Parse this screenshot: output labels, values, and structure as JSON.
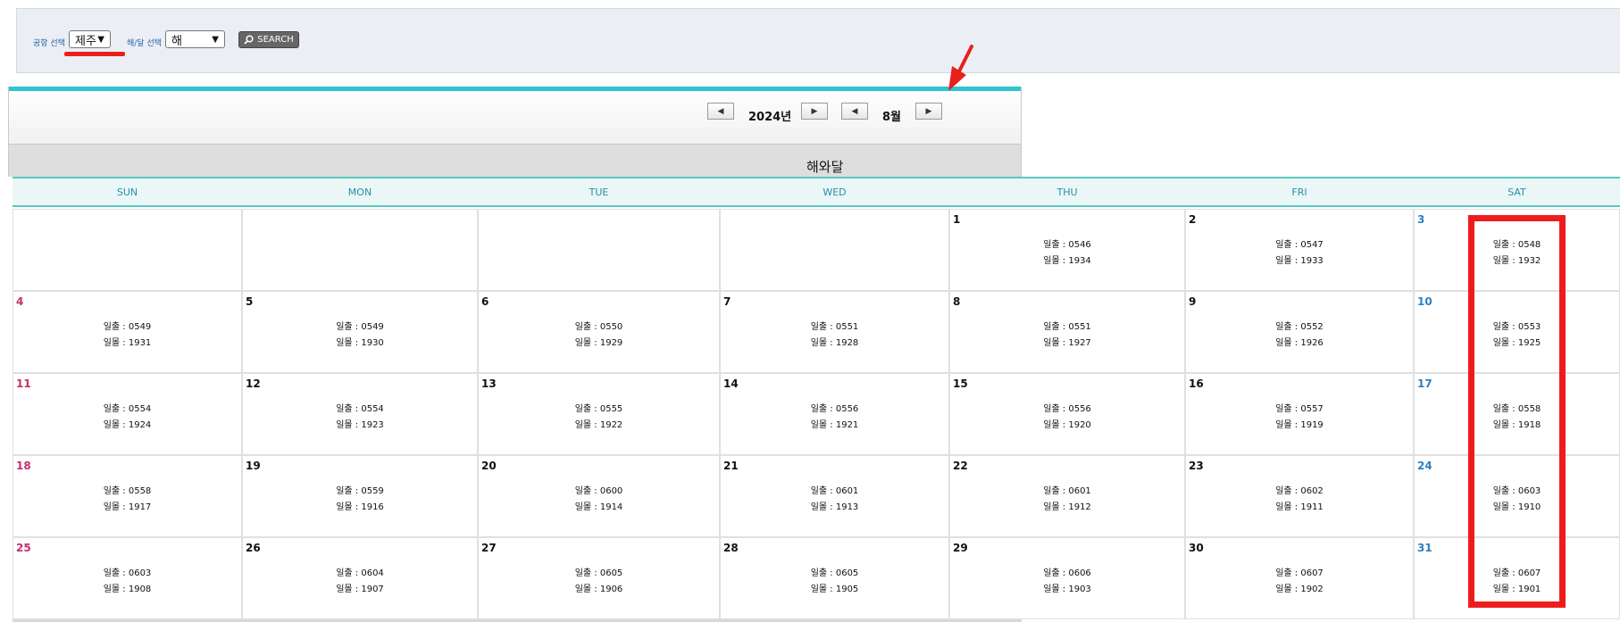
{
  "search": {
    "airport_label": "공항 선택",
    "airport_value": "제주",
    "sunmoon_label": "해/달 선택",
    "sunmoon_value": "해",
    "search_button": "SEARCH"
  },
  "nav": {
    "prev_year_icon": "◀",
    "year": "2024년",
    "next_year_icon": "▶",
    "prev_month_icon": "◀",
    "month": "8월",
    "next_month_icon": "▶"
  },
  "calendar_title": "해와달",
  "weekdays": [
    "SUN",
    "MON",
    "TUE",
    "WED",
    "THU",
    "FRI",
    "SAT"
  ],
  "rise_label": "일출 : ",
  "set_label": "일몰 : ",
  "days": [
    {
      "day": "1",
      "rise": "0546",
      "set": "1934"
    },
    {
      "day": "2",
      "rise": "0547",
      "set": "1933"
    },
    {
      "day": "3",
      "rise": "0548",
      "set": "1932"
    },
    {
      "day": "4",
      "rise": "0549",
      "set": "1931"
    },
    {
      "day": "5",
      "rise": "0549",
      "set": "1930"
    },
    {
      "day": "6",
      "rise": "0550",
      "set": "1929"
    },
    {
      "day": "7",
      "rise": "0551",
      "set": "1928"
    },
    {
      "day": "8",
      "rise": "0551",
      "set": "1927"
    },
    {
      "day": "9",
      "rise": "0552",
      "set": "1926"
    },
    {
      "day": "10",
      "rise": "0553",
      "set": "1925"
    },
    {
      "day": "11",
      "rise": "0554",
      "set": "1924"
    },
    {
      "day": "12",
      "rise": "0554",
      "set": "1923"
    },
    {
      "day": "13",
      "rise": "0555",
      "set": "1922"
    },
    {
      "day": "14",
      "rise": "0556",
      "set": "1921"
    },
    {
      "day": "15",
      "rise": "0556",
      "set": "1920"
    },
    {
      "day": "16",
      "rise": "0557",
      "set": "1919"
    },
    {
      "day": "17",
      "rise": "0558",
      "set": "1918"
    },
    {
      "day": "18",
      "rise": "0558",
      "set": "1917"
    },
    {
      "day": "19",
      "rise": "0559",
      "set": "1916"
    },
    {
      "day": "20",
      "rise": "0600",
      "set": "1914"
    },
    {
      "day": "21",
      "rise": "0601",
      "set": "1913"
    },
    {
      "day": "22",
      "rise": "0601",
      "set": "1912"
    },
    {
      "day": "23",
      "rise": "0602",
      "set": "1911"
    },
    {
      "day": "24",
      "rise": "0603",
      "set": "1910"
    },
    {
      "day": "25",
      "rise": "0603",
      "set": "1908"
    },
    {
      "day": "26",
      "rise": "0604",
      "set": "1907"
    },
    {
      "day": "27",
      "rise": "0605",
      "set": "1906"
    },
    {
      "day": "28",
      "rise": "0605",
      "set": "1905"
    },
    {
      "day": "29",
      "rise": "0606",
      "set": "1903"
    },
    {
      "day": "30",
      "rise": "0607",
      "set": "1902"
    },
    {
      "day": "31",
      "rise": "0607",
      "set": "1901"
    }
  ],
  "colors": {
    "accent_bar": "#2fc3d4",
    "header_text": "#2a8da8",
    "sunday_text": "#c2316f",
    "saturday_text": "#2f7fc0",
    "highlight": "#ee1c1c"
  }
}
